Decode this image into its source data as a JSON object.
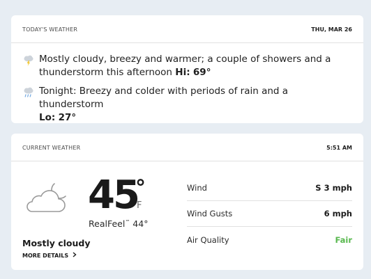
{
  "today": {
    "title": "TODAY'S WEATHER",
    "date": "THU, MAR 26",
    "day": {
      "icon": "thunderstorm-cloud-icon",
      "text": "Mostly cloudy, breezy and warmer; a couple of showers and a thunderstorm this afternoon",
      "hilo_label": "Hi:",
      "hilo_value": "69°"
    },
    "night": {
      "icon": "rain-cloud-icon",
      "text": "Tonight: Breezy and colder with periods of rain and a thunderstorm",
      "hilo_label": "Lo:",
      "hilo_value": "27°"
    }
  },
  "current": {
    "title": "CURRENT WEATHER",
    "time": "5:51 AM",
    "icon": "cloud-moon-icon",
    "temp": "45",
    "deg": "°",
    "unit": "F",
    "realfeel_label": "RealFeel",
    "realfeel_mark": "™",
    "realfeel_value": "44°",
    "condition": "Mostly cloudy",
    "more_details": "MORE DETAILS",
    "metrics": [
      {
        "label": "Wind",
        "value": "S 3 mph"
      },
      {
        "label": "Wind Gusts",
        "value": "6 mph"
      },
      {
        "label": "Air Quality",
        "value": "Fair"
      }
    ]
  },
  "colors": {
    "page_bg": "#e7edf3",
    "card_bg": "#ffffff",
    "good": "#58b84e"
  }
}
